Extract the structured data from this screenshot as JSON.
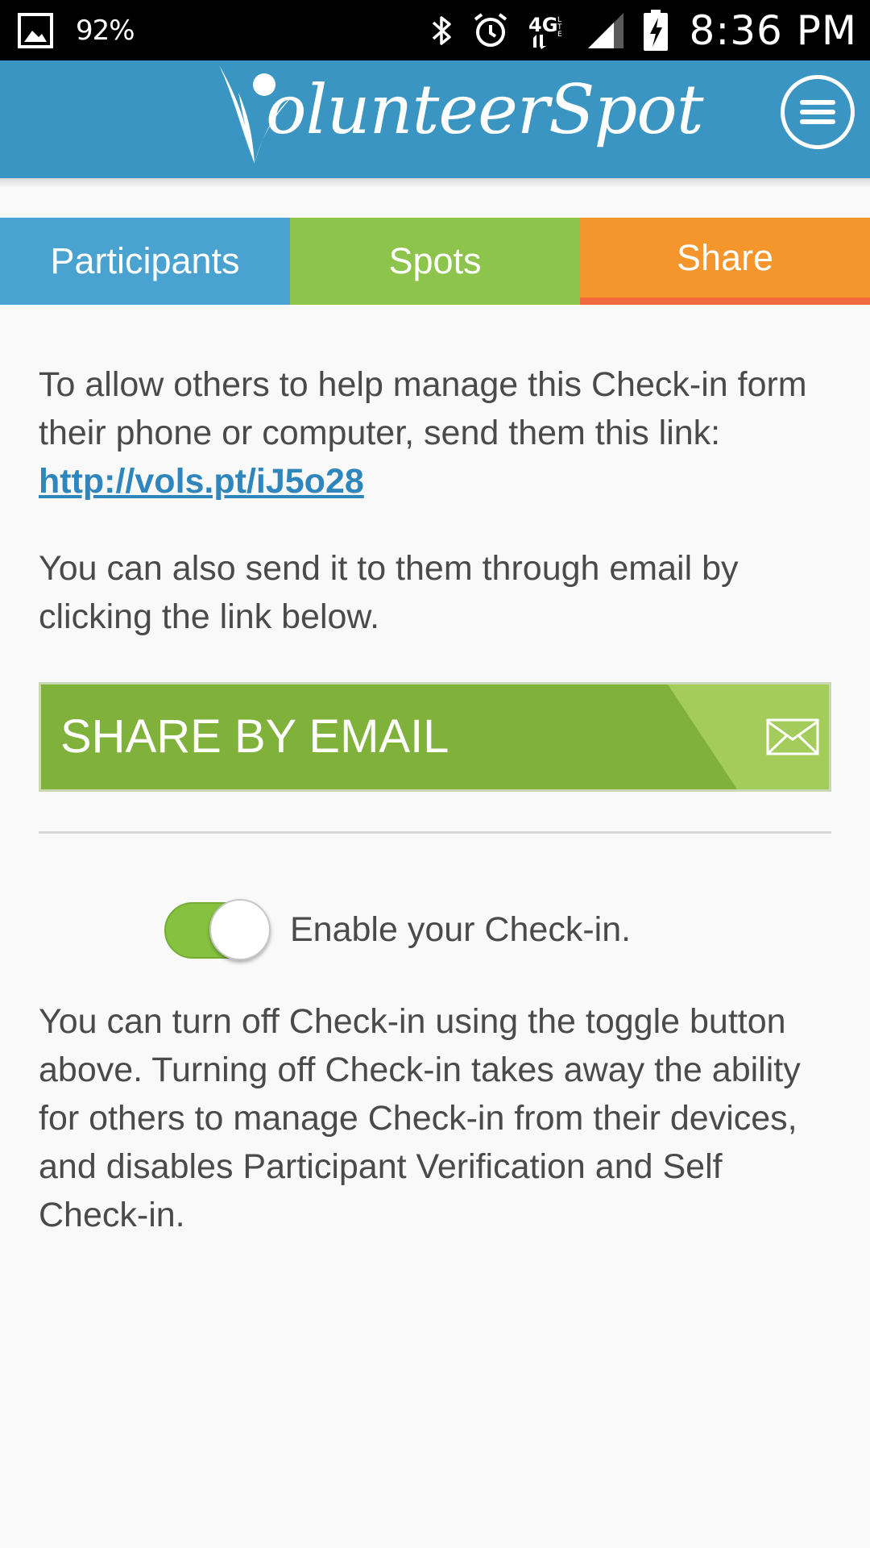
{
  "status_bar": {
    "battery_percent": "92%",
    "network": "4G LTE",
    "time": "8:36 PM",
    "icons": [
      "gallery-icon",
      "bluetooth-icon",
      "alarm-icon",
      "lte-icon",
      "signal-icon",
      "battery-charging-icon"
    ]
  },
  "header": {
    "logo_text": "olunteerSpot",
    "logo_initial": "V",
    "logo_icon": "volunteer-figure-logo",
    "menu_icon": "hamburger-menu-icon",
    "background_color": "#3a95c3"
  },
  "tabs": [
    {
      "label": "Participants",
      "color": "#49a2cf",
      "active": false
    },
    {
      "label": "Spots",
      "color": "#8dc44b",
      "active": false
    },
    {
      "label": "Share",
      "color": "#f5962d",
      "active": true
    }
  ],
  "share": {
    "intro_text": "To allow others to help manage this Check-in form their phone or computer, send them this link: ",
    "link": "http://vols.pt/iJ5o28",
    "email_text": "You can also send it to them through email by clicking the link below.",
    "email_button_label": "SHARE BY EMAIL",
    "email_icon": "envelope-icon",
    "button_color": "#80b13b"
  },
  "checkin": {
    "toggle_on": true,
    "toggle_label": "Enable your Check-in.",
    "info_text": "You can turn off Check-in using the toggle button above. Turning off Check-in takes away the ability for others to manage Check-in from their devices, and disables Participant Verification and Self Check-in."
  }
}
